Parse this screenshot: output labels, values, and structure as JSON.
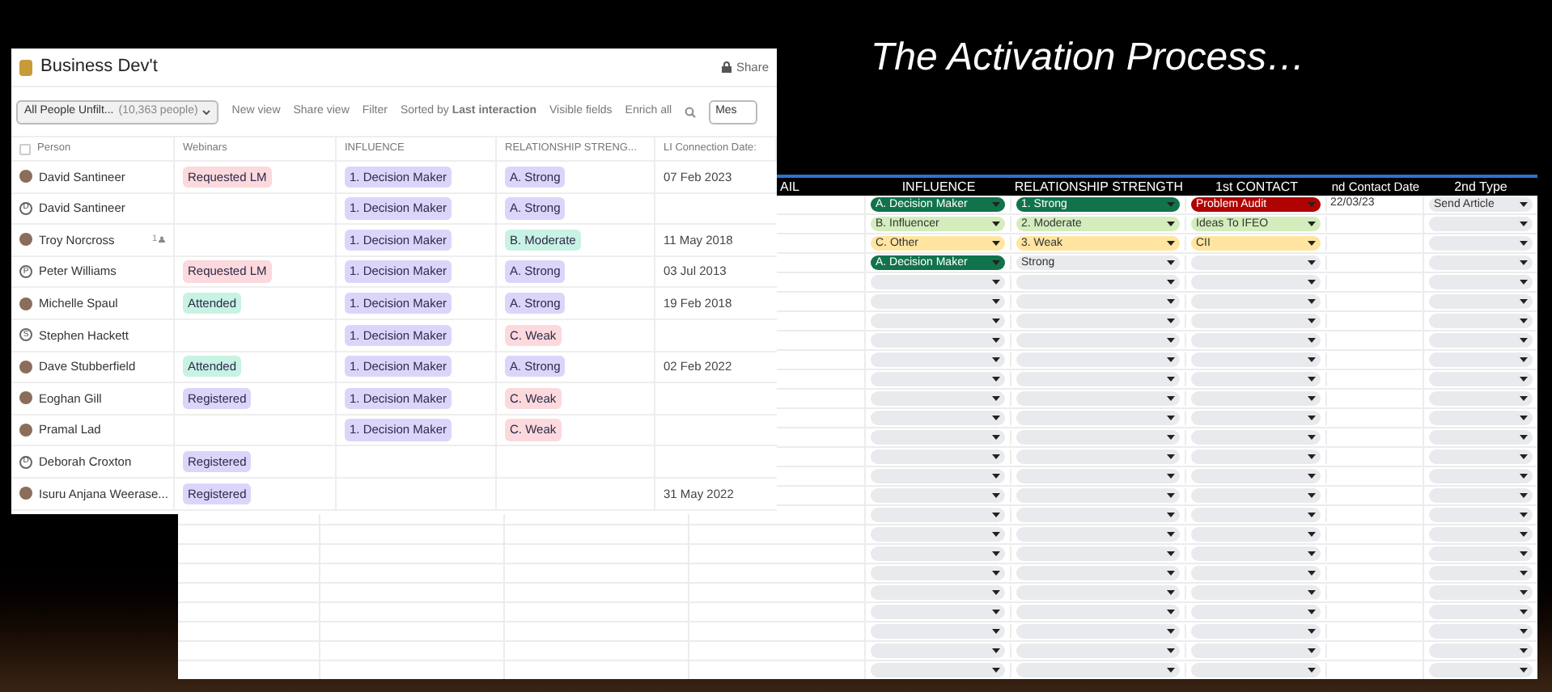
{
  "slide_title": "The Activation Process…",
  "crm": {
    "title": "Business Dev't",
    "share": "Share",
    "view": {
      "name": "All People Unfilt...",
      "count": "(10,363 people)"
    },
    "toolbar": [
      "New view",
      "Share view",
      "Filter",
      "Sorted by **Last interaction**",
      "Visible fields",
      "Enrich all"
    ],
    "search_value": "Mes",
    "select_all_checked": false,
    "columns": [
      "Person",
      "Webinars",
      "INFLUENCE",
      "RELATIONSHIP STRENG...",
      "LI Connection Date:"
    ],
    "rows": [
      {
        "name": "David Santineer",
        "avatar": {
          "kind": "photo"
        },
        "webinar": {
          "text": "Requested LM",
          "color": "#fbd9dc"
        },
        "influence": {
          "text": "1. Decision Maker",
          "color": "#dcd5fa"
        },
        "relationship": {
          "text": "A. Strong",
          "color": "#dcd5fa"
        },
        "date": "07 Feb 2023"
      },
      {
        "name": "David Santineer",
        "avatar": {
          "kind": "initial",
          "initial": "D"
        },
        "influence": {
          "text": "1. Decision Maker",
          "color": "#dcd5fa"
        },
        "relationship": {
          "text": "A. Strong",
          "color": "#dcd5fa"
        }
      },
      {
        "name": "Troy Norcross",
        "badge": "1",
        "avatar": {
          "kind": "photo"
        },
        "influence": {
          "text": "1. Decision Maker",
          "color": "#dcd5fa"
        },
        "relationship": {
          "text": "B. Moderate",
          "color": "#c8f2e4"
        },
        "date": "11 May 2018"
      },
      {
        "name": "Peter Williams",
        "avatar": {
          "kind": "initial",
          "initial": "P"
        },
        "webinar": {
          "text": "Requested LM",
          "color": "#fbd9dc"
        },
        "influence": {
          "text": "1. Decision Maker",
          "color": "#dcd5fa"
        },
        "relationship": {
          "text": "A. Strong",
          "color": "#dcd5fa"
        },
        "date": "03 Jul 2013"
      },
      {
        "name": "Michelle Spaul",
        "avatar": {
          "kind": "photo"
        },
        "webinar": {
          "text": "Attended",
          "color": "#c8f2e4"
        },
        "influence": {
          "text": "1. Decision Maker",
          "color": "#dcd5fa"
        },
        "relationship": {
          "text": "A. Strong",
          "color": "#dcd5fa"
        },
        "date": "19 Feb 2018"
      },
      {
        "name": "Stephen Hackett",
        "avatar": {
          "kind": "initial",
          "initial": "S"
        },
        "influence": {
          "text": "1. Decision Maker",
          "color": "#dcd5fa"
        },
        "relationship": {
          "text": "C. Weak",
          "color": "#fbd9dc"
        }
      },
      {
        "name": "Dave Stubberfield",
        "avatar": {
          "kind": "photo"
        },
        "webinar": {
          "text": "Attended",
          "color": "#c8f2e4"
        },
        "influence": {
          "text": "1. Decision Maker",
          "color": "#dcd5fa"
        },
        "relationship": {
          "text": "A. Strong",
          "color": "#dcd5fa"
        },
        "date": "02 Feb 2022"
      },
      {
        "name": "Eoghan Gill",
        "avatar": {
          "kind": "photo"
        },
        "webinar": {
          "text": "Registered",
          "color": "#dcd5fa"
        },
        "influence": {
          "text": "1. Decision Maker",
          "color": "#dcd5fa"
        },
        "relationship": {
          "text": "C. Weak",
          "color": "#fbd9dc"
        }
      },
      {
        "name": "Pramal Lad",
        "avatar": {
          "kind": "photo"
        },
        "influence": {
          "text": "1. Decision Maker",
          "color": "#dcd5fa"
        },
        "relationship": {
          "text": "C. Weak",
          "color": "#fbd9dc"
        }
      },
      {
        "name": "Deborah Croxton",
        "avatar": {
          "kind": "initial",
          "initial": "D"
        },
        "webinar": {
          "text": "Registered",
          "color": "#dcd5fa"
        }
      },
      {
        "name": "Isuru Anjana Weerase...",
        "avatar": {
          "kind": "photo"
        },
        "webinar": {
          "text": "Registered",
          "color": "#dcd5fa"
        },
        "date": "31 May 2022"
      }
    ]
  },
  "sheet": {
    "columns": [
      "AIL",
      "INFLUENCE",
      "RELATIONSHIP STRENGTH",
      "1st CONTACT",
      "nd Contact Date",
      "2nd Type"
    ],
    "rows": [
      {
        "kind": "filled",
        "influence": {
          "text": "A. Decision Maker",
          "color": "#11734b"
        },
        "relationship": {
          "text": "1. Strong",
          "color": "#11734b"
        },
        "first_contact": {
          "text": "Problem Audit",
          "color": "#b10202"
        },
        "contact_date": "22/03/23",
        "type": {
          "text": "Send Article",
          "color": "#e8eaed"
        }
      },
      {
        "kind": "filled",
        "influence": {
          "text": "B. Influencer",
          "color": "#d4edbc"
        },
        "relationship": {
          "text": "2. Moderate",
          "color": "#d4edbc"
        },
        "first_contact": {
          "text": "Ideas To IFEO",
          "color": "#d4edbc"
        },
        "type": {
          "color": "#e8eaed"
        }
      },
      {
        "kind": "filled",
        "influence": {
          "text": "C. Other",
          "color": "#ffe5a0"
        },
        "relationship": {
          "text": "3. Weak",
          "color": "#ffe5a0"
        },
        "first_contact": {
          "text": "CII",
          "color": "#ffe5a0"
        },
        "type": {
          "color": "#e8eaed"
        }
      },
      {
        "kind": "filled",
        "influence": {
          "text": "A. Decision Maker",
          "color": "#11734b"
        },
        "relationship": {
          "text": "Strong",
          "color": "#e8eaed"
        },
        "first_contact": {
          "color": "#e8eaed"
        },
        "type": {
          "color": "#e8eaed"
        }
      },
      {
        "kind": "empty"
      },
      {
        "kind": "empty"
      },
      {
        "kind": "empty"
      },
      {
        "kind": "empty"
      },
      {
        "kind": "empty"
      },
      {
        "kind": "empty"
      },
      {
        "kind": "empty"
      },
      {
        "kind": "empty"
      },
      {
        "kind": "empty"
      },
      {
        "kind": "empty"
      },
      {
        "kind": "empty"
      },
      {
        "kind": "empty"
      },
      {
        "kind": "empty"
      },
      {
        "kind": "empty"
      },
      {
        "kind": "empty"
      },
      {
        "kind": "empty"
      },
      {
        "kind": "empty"
      },
      {
        "kind": "empty"
      },
      {
        "kind": "empty"
      },
      {
        "kind": "empty"
      },
      {
        "kind": "empty"
      }
    ]
  }
}
